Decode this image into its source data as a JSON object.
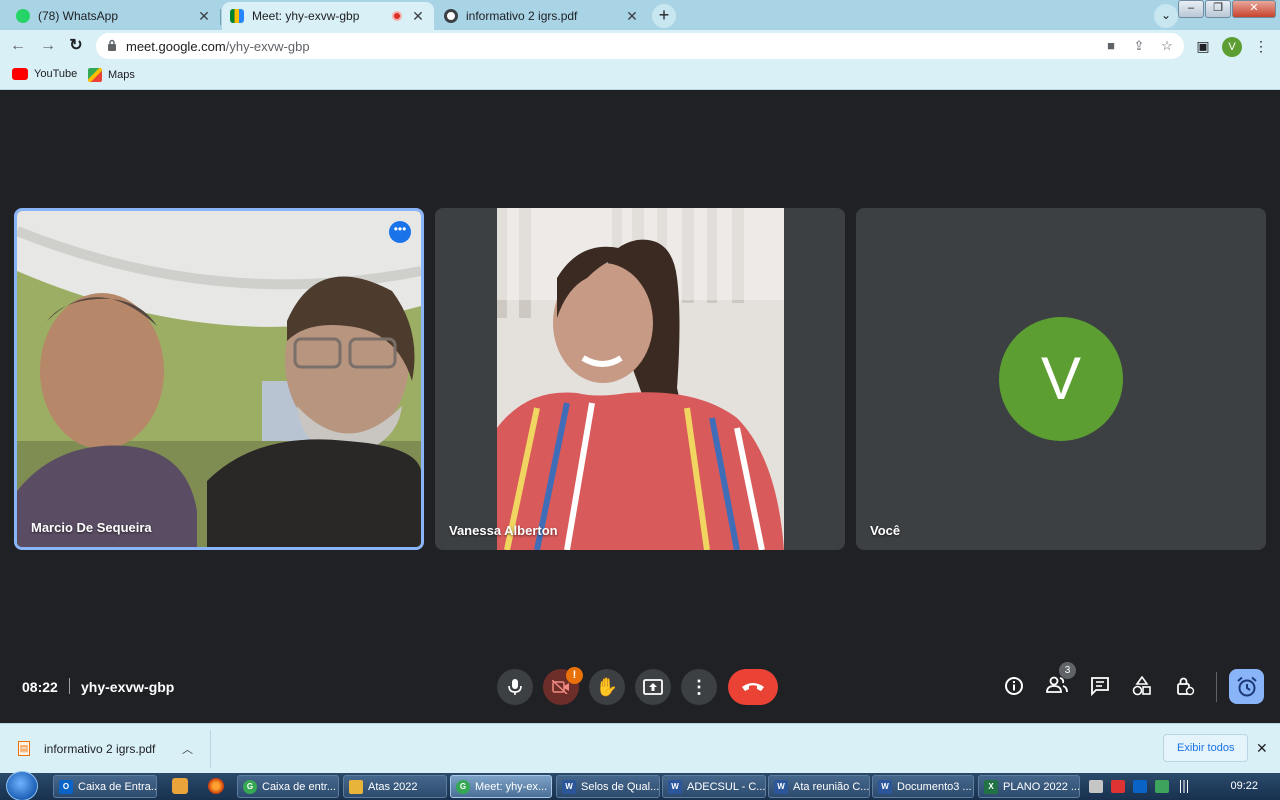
{
  "browser": {
    "tabs": [
      {
        "title": "(78) WhatsApp",
        "active": false
      },
      {
        "title": "Meet: yhy-exvw-gbp",
        "active": true
      },
      {
        "title": "informativo 2 igrs.pdf",
        "active": false
      }
    ],
    "new_tab_symbol": "+",
    "address_host": "meet.google.com",
    "address_path": "/yhy-exvw-gbp",
    "profile_initial": "V",
    "bookmarks": [
      {
        "label": "YouTube",
        "icon": "youtube-icon"
      },
      {
        "label": "Maps",
        "icon": "maps-icon"
      }
    ]
  },
  "meet": {
    "participants": [
      {
        "name": "Marcio De Sequeira",
        "pinned": true
      },
      {
        "name": "Vanessa Alberton",
        "pinned": false
      },
      {
        "name": "Você",
        "avatar_initial": "V",
        "pinned": false
      }
    ],
    "time": "08:22",
    "meeting_code": "yhy-exvw-gbp",
    "camera_warning_badge": "!",
    "people_count": "3"
  },
  "downloads": {
    "file": "informativo 2 igrs.pdf",
    "show_all": "Exibir todos"
  },
  "taskbar": {
    "items": [
      {
        "label": "Caixa de Entra...",
        "icon": "outlook-icon",
        "color": "#0a64c8",
        "glyph": "O"
      },
      {
        "label": "Caixa de entr...",
        "icon": "chrome-icon",
        "color": "#34a853",
        "glyph": "G"
      },
      {
        "label": "Atas 2022",
        "icon": "folder-icon",
        "color": "#e8b53a",
        "glyph": ""
      },
      {
        "label": "Meet: yhy-ex...",
        "icon": "chrome-icon",
        "color": "#34a853",
        "glyph": "G"
      },
      {
        "label": "Selos de Qual...",
        "icon": "word-icon",
        "color": "#2b579a",
        "glyph": "W"
      },
      {
        "label": "ADECSUL - C...",
        "icon": "word-icon",
        "color": "#2b579a",
        "glyph": "W"
      },
      {
        "label": "Ata reunião C...",
        "icon": "word-icon",
        "color": "#2b579a",
        "glyph": "W"
      },
      {
        "label": "Documento3 ...",
        "icon": "word-icon",
        "color": "#2b579a",
        "glyph": "W"
      },
      {
        "label": "PLANO 2022 ...",
        "icon": "excel-icon",
        "color": "#217346",
        "glyph": "X"
      }
    ],
    "clock": "09:22"
  }
}
